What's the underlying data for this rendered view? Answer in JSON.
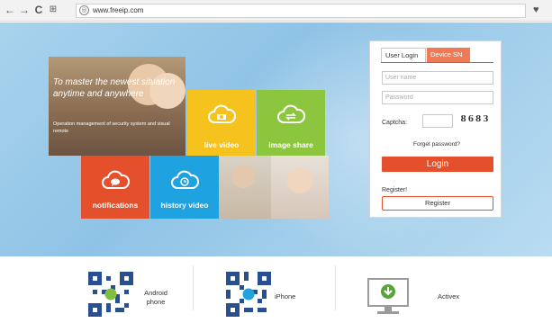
{
  "browser": {
    "url": "www.freeip.com",
    "icons": [
      "back-arrow-icon",
      "forward-arrow-icon",
      "reload-icon",
      "apps-grid-icon",
      "globe-icon",
      "heart-icon"
    ]
  },
  "hero": {
    "banner_title": "To master the newest situation anytime and anywhere",
    "banner_subtitle": "Operation management of security system and visual remote",
    "tiles": {
      "live_video": "live video",
      "image_share": "image share",
      "notifications": "notifications",
      "history_video": "history video"
    },
    "colors": {
      "yellow": "#f6c21e",
      "green": "#8cc63e",
      "red": "#e4502b",
      "blue": "#1fa2e0"
    }
  },
  "login": {
    "tab_user": "User Login",
    "tab_device": "Device SN",
    "username_placeholder": "User name",
    "password_placeholder": "Password",
    "captcha_label": "Captcha:",
    "captcha_code": "8683",
    "forgot": "Forget password?",
    "login_button": "Login",
    "register_label": "Register!",
    "register_button": "Register",
    "accent": "#e4502b"
  },
  "downloads": {
    "android": "Android phone",
    "iphone": "iPhone",
    "activex": "Activex"
  }
}
